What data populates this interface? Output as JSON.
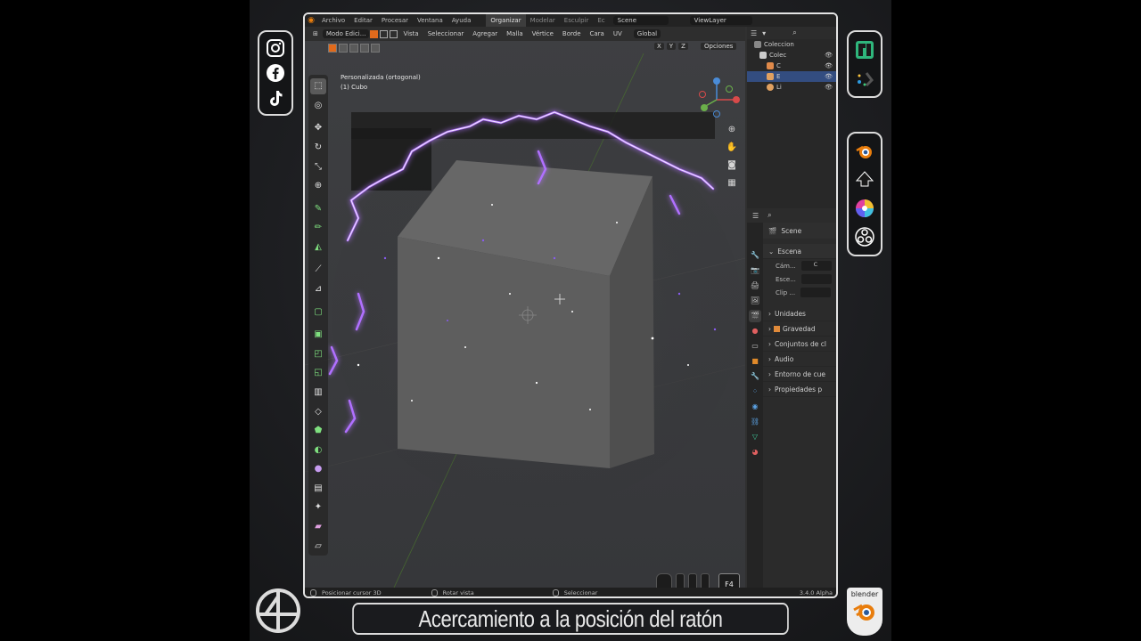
{
  "topbar": {
    "menus": [
      "Archivo",
      "Editar",
      "Procesar",
      "Ventana",
      "Ayuda"
    ],
    "workspaces": [
      "Organizar",
      "Modelar",
      "Esculpir",
      "Ec"
    ],
    "active_workspace": "Organizar",
    "scene": "Scene",
    "view_layer": "ViewLayer"
  },
  "viewport": {
    "mode": "Modo Edici...",
    "menus": [
      "Vista",
      "Seleccionar",
      "Agregar",
      "Malla",
      "Vértice",
      "Borde",
      "Cara",
      "UV"
    ],
    "transform_orientation": "Global",
    "axes": [
      "X",
      "Y",
      "Z"
    ],
    "options": "Opciones",
    "info_line1": "Personalizada (ortogonal)",
    "info_line2": "(1) Cubo",
    "key_label": "F4"
  },
  "outliner": {
    "title": "Coleccion",
    "rows": [
      "Colec",
      "C",
      "E",
      "Li"
    ]
  },
  "properties": {
    "context": "Scene",
    "sections": [
      "Escena",
      "Unidades",
      "Gravedad",
      "Conjuntos de cl",
      "Audio",
      "Entorno de cue",
      "Propiedades p"
    ],
    "fields": [
      "Cám...",
      "Esce...",
      "Clip ..."
    ],
    "camera_value": "C"
  },
  "statusbar": {
    "left": "Posicionar cursor 3D",
    "middle": "Rotar vista",
    "right": "Seleccionar",
    "version": "3.4.0 Alpha"
  },
  "caption": "Acercamiento a la posición del ratón",
  "badge": "blender",
  "colors": {
    "accent_orange": "#e06a1c",
    "electric_purple": "#a040ff",
    "selection_blue": "#334d80"
  },
  "icons": {
    "social": [
      "instagram-icon",
      "facebook-icon",
      "tiktok-icon"
    ],
    "apps": [
      "manjaro-icon",
      "kde-icon",
      "blender-icon",
      "inkscape-icon",
      "color-wheel-icon",
      "obs-icon"
    ]
  }
}
